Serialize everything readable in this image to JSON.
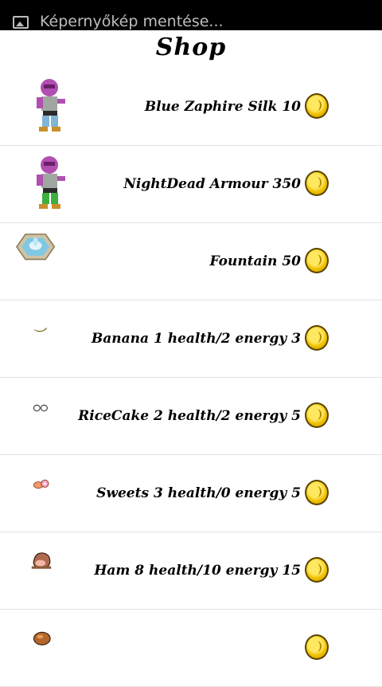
{
  "statusbar": {
    "notification": "Képernyőkép mentése..."
  },
  "page": {
    "title": "Shop"
  },
  "items": [
    {
      "label": "Blue Zaphire Silk 10",
      "icon": "character-blue-silk-sprite"
    },
    {
      "label": "NightDead Armour 350",
      "icon": "character-armour-sprite"
    },
    {
      "label": "Fountain 50",
      "icon": "fountain-sprite"
    },
    {
      "label": "Banana 1 health/2 energy  3",
      "icon": "banana-sprite"
    },
    {
      "label": "RiceCake 2 health/2 energy  5",
      "icon": "ricecake-sprite"
    },
    {
      "label": "Sweets 3 health/0 energy  5",
      "icon": "sweets-sprite"
    },
    {
      "label": "Ham 8 health/10 energy  15",
      "icon": "ham-sprite"
    },
    {
      "label": "",
      "icon": "meat-sprite"
    }
  ],
  "currency_icon": "gold-coin-icon",
  "colors": {
    "statusbar": "#000000",
    "background": "#ffffff",
    "coin": "#f0c000",
    "divider": "#e2e2e2"
  }
}
